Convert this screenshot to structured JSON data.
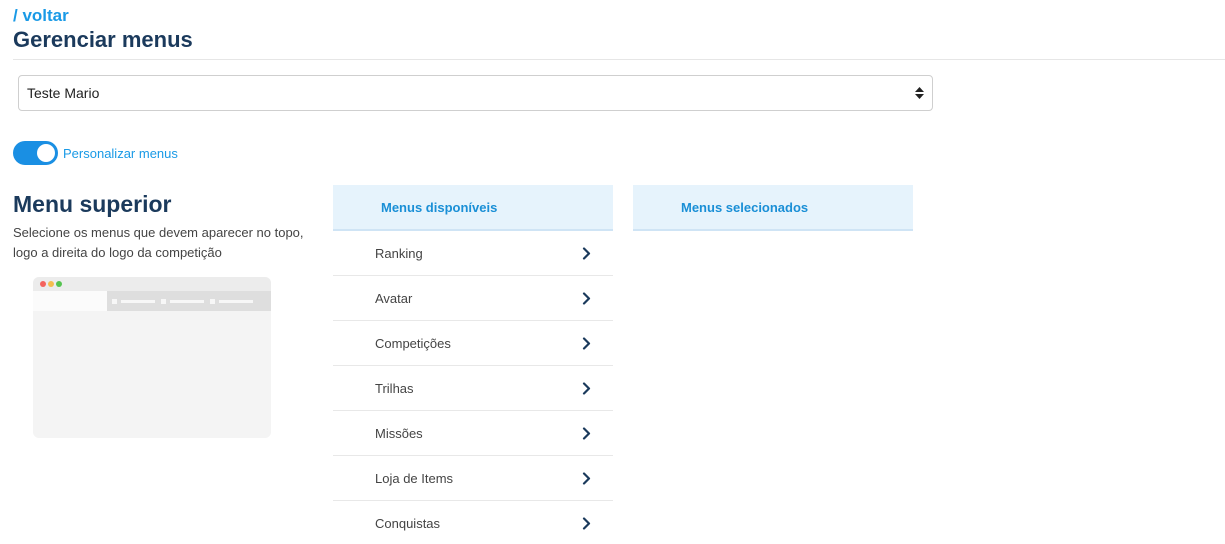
{
  "header": {
    "back_label": "/ voltar",
    "title": "Gerenciar menus"
  },
  "selector": {
    "value": "Teste Mario",
    "arrows": "up-down-caret-icon"
  },
  "toggle": {
    "on": true,
    "label": "Personalizar menus",
    "accent": "#1a8fe3"
  },
  "section": {
    "title": "Menu superior",
    "description": "Selecione os menus que devem aparecer no topo, logo a direita do logo da competição"
  },
  "available": {
    "header": "Menus disponíveis",
    "items": [
      {
        "label": "Ranking"
      },
      {
        "label": "Avatar"
      },
      {
        "label": "Competições"
      },
      {
        "label": "Trilhas"
      },
      {
        "label": "Missões"
      },
      {
        "label": "Loja de Items"
      },
      {
        "label": "Conquistas"
      }
    ]
  },
  "selected": {
    "header": "Menus selecionados",
    "items": []
  },
  "colors": {
    "brand_blue": "#1a9ae6",
    "title_navy": "#1b3a5c",
    "header_bg": "#e6f3fc"
  }
}
